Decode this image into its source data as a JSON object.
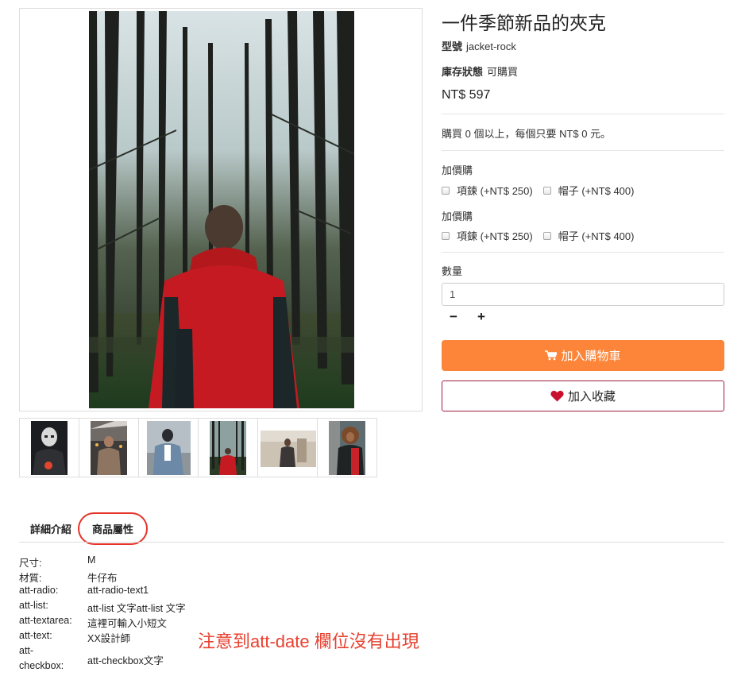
{
  "product": {
    "title": "一件季節新品的夾克",
    "model_label": "型號",
    "model_value": "jacket-rock",
    "stock_label": "庫存狀態",
    "stock_value": "可購買",
    "price": "NT$ 597",
    "bulk_note": "購買 0 個以上，每個只要 NT$ 0 元。"
  },
  "addons": [
    {
      "title": "加價購",
      "options": [
        "項鍊 (+NT$ 250)",
        "帽子 (+NT$ 400)"
      ]
    },
    {
      "title": "加價購",
      "options": [
        "項鍊 (+NT$ 250)",
        "帽子 (+NT$ 400)"
      ]
    }
  ],
  "quantity": {
    "label": "數量",
    "value": "1",
    "minus": "−",
    "plus": "+"
  },
  "buttons": {
    "cart_label": "加入購物車",
    "cart_icon": "shopping-cart-icon",
    "wishlist_label": "加入收藏",
    "wishlist_icon": "heart-icon"
  },
  "colors": {
    "cart_button": "#fd8539",
    "wishlist_border": "#a01c3c",
    "heart": "#c8102e",
    "annotation": "#e8402f"
  },
  "thumbnails": [
    {
      "name": "thumb-masked-person"
    },
    {
      "name": "thumb-woman-coat"
    },
    {
      "name": "thumb-man-denim"
    },
    {
      "name": "thumb-forest-jacket"
    },
    {
      "name": "thumb-man-wall"
    },
    {
      "name": "thumb-woman-curly"
    }
  ],
  "tabs": {
    "details": "詳細介紹",
    "attributes": "商品屬性"
  },
  "attributes": [
    {
      "key": "尺寸:",
      "value": "M"
    },
    {
      "key": "材質:",
      "value": "牛仔布"
    },
    {
      "key": "att-radio:",
      "value": "att-radio-text1"
    },
    {
      "key": "att-list:",
      "value": "att-list 文字att-list 文字"
    },
    {
      "key": "att-textarea:",
      "value": "這裡可輸入小短文"
    },
    {
      "key": "att-text:",
      "value": "XX設計師"
    },
    {
      "key": "att-checkbox:",
      "key_line1": "att-",
      "key_line2": "checkbox:",
      "value": "att-checkbox文字"
    }
  ],
  "annotation": "注意到att-date 欄位沒有出現"
}
